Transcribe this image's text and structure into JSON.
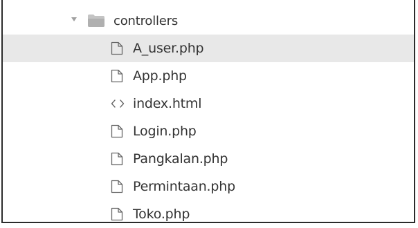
{
  "folder": {
    "name": "controllers",
    "expanded": true
  },
  "files": [
    {
      "name": "A_user.php",
      "icon": "file-icon",
      "selected": true
    },
    {
      "name": "App.php",
      "icon": "file-icon",
      "selected": false
    },
    {
      "name": "index.html",
      "icon": "code-icon",
      "selected": false
    },
    {
      "name": "Login.php",
      "icon": "file-icon",
      "selected": false
    },
    {
      "name": "Pangkalan.php",
      "icon": "file-icon",
      "selected": false
    },
    {
      "name": "Permintaan.php",
      "icon": "file-icon",
      "selected": false
    },
    {
      "name": "Toko.php",
      "icon": "file-icon",
      "selected": false
    }
  ],
  "colors": {
    "selected_background": "#e8e8e8",
    "text": "#333333",
    "icon": "#666666",
    "folder_icon": "#bdbdbd"
  }
}
